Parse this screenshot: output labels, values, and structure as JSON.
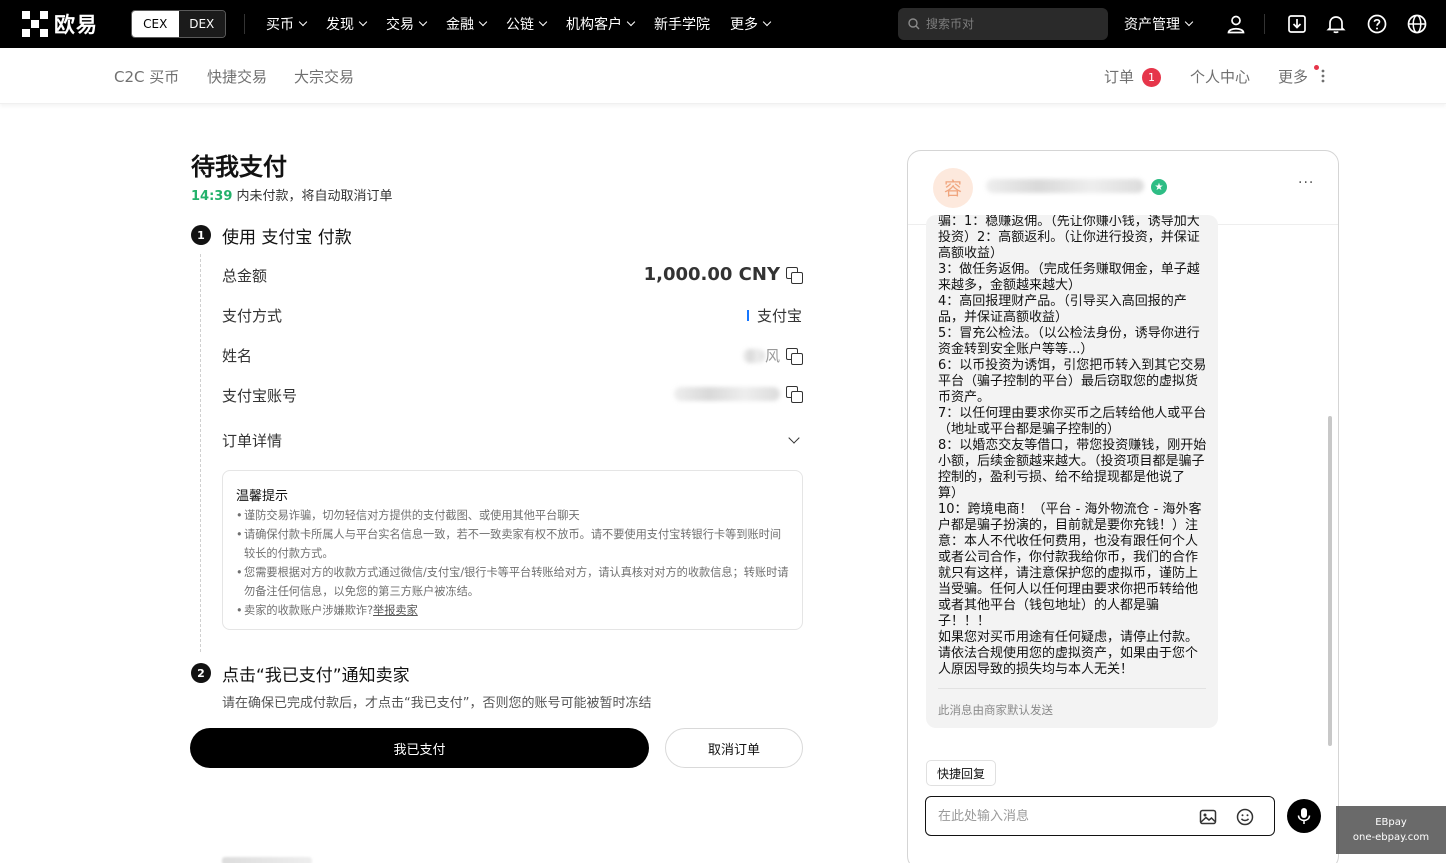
{
  "brand": {
    "name": "欧易"
  },
  "switcher": {
    "cex": "CEX",
    "dex": "DEX"
  },
  "nav": {
    "items": [
      {
        "label": "买币",
        "dropdown": true
      },
      {
        "label": "发现",
        "dropdown": true
      },
      {
        "label": "交易",
        "dropdown": true
      },
      {
        "label": "金融",
        "dropdown": true
      },
      {
        "label": "公链",
        "dropdown": true
      },
      {
        "label": "机构客户",
        "dropdown": true
      },
      {
        "label": "新手学院",
        "dropdown": false
      },
      {
        "label": "更多",
        "dropdown": true
      }
    ],
    "search_placeholder": "搜索币对",
    "asset_label": "资产管理"
  },
  "subnav": {
    "left": [
      "C2C 买币",
      "快捷交易",
      "大宗交易"
    ],
    "order_label": "订单",
    "order_count": "1",
    "profile_label": "个人中心",
    "more_label": "更多"
  },
  "order": {
    "title": "待我支付",
    "countdown": "14:39",
    "countdown_suffix": " 内未付款，将自动取消订单",
    "step1": {
      "num": "1",
      "title": "使用 支付宝 付款"
    },
    "rows": {
      "amount_label": "总金额",
      "amount_value": "1,000.00 CNY",
      "method_label": "支付方式",
      "method_value": "支付宝",
      "name_label": "姓名",
      "name_tail": "风",
      "account_label": "支付宝账号"
    },
    "details_label": "订单详情",
    "tips": {
      "title": "温馨提示",
      "items": [
        "谨防交易诈骗，切勿轻信对方提供的支付截图、或使用其他平台聊天",
        "请确保付款卡所属人与平台实名信息一致，若不一致卖家有权不放币。请不要使用支付宝转银行卡等到账时间较长的付款方式。",
        "您需要根据对方的收款方式通过微信/支付宝/银行卡等平台转账给对方，请认真核对对方的收款信息；转账时请勿备注任何信息，以免您的第三方账户被冻结。"
      ],
      "last_prefix": "卖家的收款账户涉嫌欺诈?",
      "report_link": "举报卖家"
    },
    "step2": {
      "num": "2",
      "title": "点击“我已支付”通知卖家",
      "desc": "请在确保已完成付款后，才点击“我已支付”，否则您的账号可能被暂时冻结"
    },
    "paid_button": "我已支付",
    "cancel_button": "取消订单"
  },
  "chat": {
    "avatar_char": "容",
    "more": "···",
    "message": "骗：1：稳赚返佣。（先让你赚小钱，诱导加大投资）2：高额返利。（让你进行投资，并保证高额收益）\n3：做任务返佣。（完成任务赚取佣金，单子越来越多，金额越来越大）\n4：高回报理财产品。（引导买入高回报的产品，并保证高额收益）\n5：冒充公检法。（以公检法身份，诱导你进行资金转到安全账户等等...）\n6：以币投资为诱饵，引您把币转入到其它交易平台（骗子控制的平台）最后窃取您的虚拟货币资产。\n7：以任何理由要求你买币之后转给他人或平台（地址或平台都是骗子控制的）\n8：以婚恋交友等借口，带您投资赚钱，刚开始小额，后续金额越来越大。（投资项目都是骗子控制的，盈利亏损、给不给提现都是他说了算）\n10：跨境电商！（平台 - 海外物流仓 - 海外客户都是骗子扮演的，目前就是要你充钱！）注意：本人不代收任何费用，也没有跟任何个人或者公司合作，你付款我给你币，我们的合作就只有这样，请注意保护您的虚拟币，谨防上当受骗。任何人以任何理由要求你把币转给他或者其他平台（钱包地址）的人都是骗子！！！\n如果您对买币用途有任何疑虑，请停止付款。请依法合规使用您的虚拟资产，如果由于您个人原因导致的损失均与本人无关！",
    "auto_note": "此消息由商家默认发送",
    "quick_reply": "快捷回复",
    "input_placeholder": "在此处输入消息"
  },
  "watermark": {
    "line1": "EBpay",
    "line2": "one-ebpay.com"
  }
}
